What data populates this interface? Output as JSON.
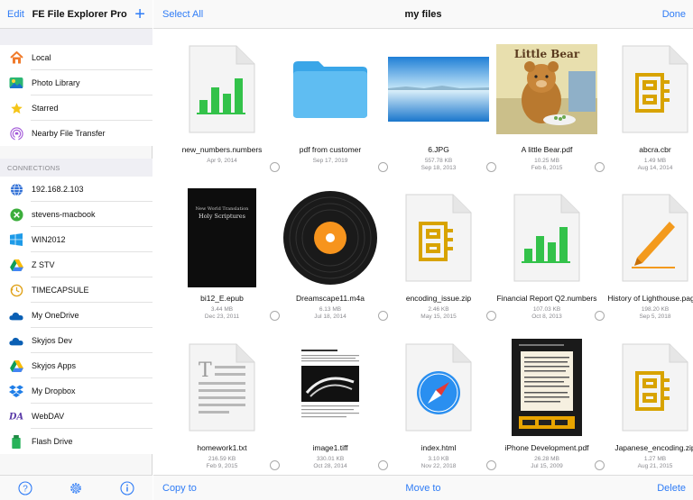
{
  "sidebar": {
    "edit_label": "Edit",
    "app_title": "FE File Explorer Pro",
    "add_label": "+",
    "places": [
      {
        "label": "Local",
        "icon": "home-icon"
      },
      {
        "label": "Photo Library",
        "icon": "photos-icon"
      },
      {
        "label": "Starred",
        "icon": "star-icon"
      },
      {
        "label": "Nearby File Transfer",
        "icon": "airdrop-icon"
      }
    ],
    "connections_header": "CONNECTIONS",
    "connections": [
      {
        "label": "192.168.2.103",
        "icon": "globe-icon"
      },
      {
        "label": "stevens-macbook",
        "icon": "x-server-icon"
      },
      {
        "label": "WIN2012",
        "icon": "windows-icon"
      },
      {
        "label": "Z STV",
        "icon": "google-drive-icon"
      },
      {
        "label": "TIMECAPSULE",
        "icon": "time-machine-icon"
      },
      {
        "label": "My OneDrive",
        "icon": "onedrive-icon"
      },
      {
        "label": "Skyjos Dev",
        "icon": "onedrive-icon"
      },
      {
        "label": "Skyjos Apps",
        "icon": "google-drive-icon"
      },
      {
        "label": "My Dropbox",
        "icon": "dropbox-icon"
      },
      {
        "label": "WebDAV",
        "icon": "webdav-icon"
      },
      {
        "label": "Flash Drive",
        "icon": "flash-drive-icon"
      }
    ],
    "footer": [
      "help-icon",
      "settings-icon",
      "info-icon"
    ]
  },
  "toolbar": {
    "select_all": "Select All",
    "title": "my files",
    "done": "Done"
  },
  "files": [
    {
      "name": "new_numbers.numbers",
      "size": "",
      "date": "Apr 9, 2014",
      "icon": "numbers-doc-icon"
    },
    {
      "name": "pdf from customer",
      "size": "",
      "date": "Sep 17, 2019",
      "icon": "folder-icon"
    },
    {
      "name": "6.JPG",
      "size": "557.78 KB",
      "date": "Sep 18, 2013",
      "icon": "photo-thumbnail"
    },
    {
      "name": "A little Bear.pdf",
      "size": "10.25 MB",
      "date": "Feb 6, 2015",
      "icon": "book-cover-thumbnail",
      "cover_title": "Little Bear"
    },
    {
      "name": "abcra.cbr",
      "size": "1.49 MB",
      "date": "Aug 14, 2014",
      "icon": "archive-doc-icon"
    },
    {
      "name": "bi12_E.epub",
      "size": "3.44 MB",
      "date": "Dec 23, 2011",
      "icon": "epub-cover-thumbnail",
      "cover_top": "New World Translation",
      "cover_title": "Holy Scriptures"
    },
    {
      "name": "Dreamscape11.m4a",
      "size": "6.13 MB",
      "date": "Jul 18, 2014",
      "icon": "vinyl-record-icon"
    },
    {
      "name": "encoding_issue.zip",
      "size": "2.46 KB",
      "date": "May 15, 2015",
      "icon": "archive-doc-icon"
    },
    {
      "name": "Financial Report  Q2.numbers",
      "size": "107.03 KB",
      "date": "Oct 8, 2013",
      "icon": "numbers-doc-icon"
    },
    {
      "name": "History of Lighthouse.pages",
      "size": "198.20 KB",
      "date": "Sep 5, 2018",
      "icon": "pages-doc-icon"
    },
    {
      "name": "homework1.txt",
      "size": "216.59 KB",
      "date": "Feb 9, 2015",
      "icon": "text-doc-icon"
    },
    {
      "name": "image1.tiff",
      "size": "330.01 KB",
      "date": "Oct 28, 2014",
      "icon": "tiff-thumbnail"
    },
    {
      "name": "index.html",
      "size": "3.10 KB",
      "date": "Nov 22, 2018",
      "icon": "safari-doc-icon"
    },
    {
      "name": "iPhone Development.pdf",
      "size": "26.28 MB",
      "date": "Jul 15, 2009",
      "icon": "pdf-page-thumbnail"
    },
    {
      "name": "Japanese_encoding.zip",
      "size": "1.27 MB",
      "date": "Aug 21, 2015",
      "icon": "archive-doc-icon"
    }
  ],
  "bottom": {
    "copy_to": "Copy to",
    "move_to": "Move to",
    "delete": "Delete"
  },
  "colors": {
    "accent": "#2f7cf6",
    "numbers_green": "#33c24a",
    "archive_gold": "#d8a300",
    "pages_orange": "#f39a1d",
    "folder_blue": "#4fb3ef"
  }
}
